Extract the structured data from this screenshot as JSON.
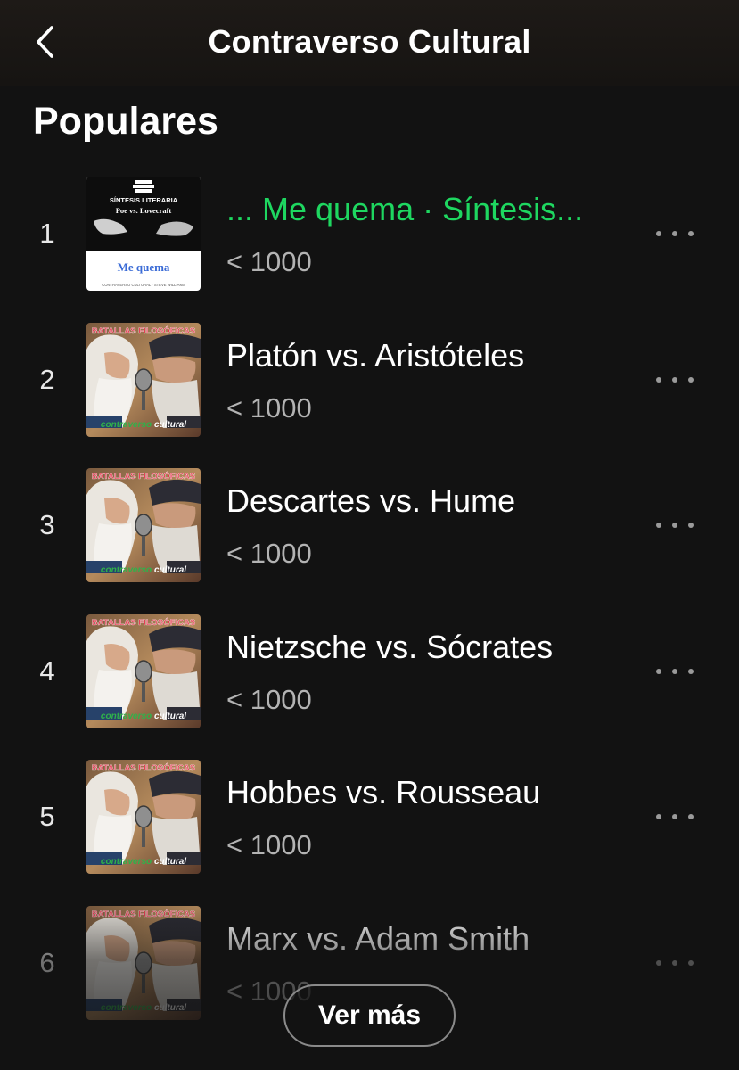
{
  "header": {
    "title": "Contraverso Cultural",
    "back_icon": "chevron-left-icon"
  },
  "section": {
    "title": "Populares"
  },
  "colors": {
    "accent": "#1ed760",
    "background": "#121212",
    "secondary_text": "#b3b3b3"
  },
  "tracks": [
    {
      "number": "1",
      "title": "... Me quema · Síntesis...",
      "plays": "< 1000",
      "playing": true,
      "cover": {
        "type": "sintesis",
        "top_text": "SÍNTESIS LITERARIA",
        "subtitle": "Poe vs. Lovecraft",
        "caption": "Me quema",
        "footer": "CONTRAVERSO CULTURAL · STEVE WILLIAMS"
      }
    },
    {
      "number": "2",
      "title": "Platón vs. Aristóteles",
      "plays": "< 1000",
      "playing": false,
      "cover": {
        "type": "batallas",
        "top_text": "BATALLAS FILOSÓFICAS",
        "footer_a": "contraverso",
        "footer_b": "cultural"
      }
    },
    {
      "number": "3",
      "title": "Descartes vs. Hume",
      "plays": "< 1000",
      "playing": false,
      "cover": {
        "type": "batallas",
        "top_text": "BATALLAS FILOSÓFICAS",
        "footer_a": "contraverso",
        "footer_b": "cultural"
      }
    },
    {
      "number": "4",
      "title": "Nietzsche vs. Sócrates",
      "plays": "< 1000",
      "playing": false,
      "cover": {
        "type": "batallas",
        "top_text": "BATALLAS FILOSÓFICAS",
        "footer_a": "contraverso",
        "footer_b": "cultural"
      }
    },
    {
      "number": "5",
      "title": "Hobbes vs. Rousseau",
      "plays": "< 1000",
      "playing": false,
      "cover": {
        "type": "batallas",
        "top_text": "BATALLAS FILOSÓFICAS",
        "footer_a": "contraverso",
        "footer_b": "cultural"
      }
    },
    {
      "number": "6",
      "title": "Marx vs. Adam Smith",
      "plays": "< 1000",
      "playing": false,
      "cover": {
        "type": "batallas",
        "top_text": "BATALLAS FILOSÓFICAS",
        "footer_a": "contraverso",
        "footer_b": "cultural"
      }
    }
  ],
  "more_button": {
    "label": "Ver más"
  },
  "more_options_icon": "more-horizontal-icon"
}
